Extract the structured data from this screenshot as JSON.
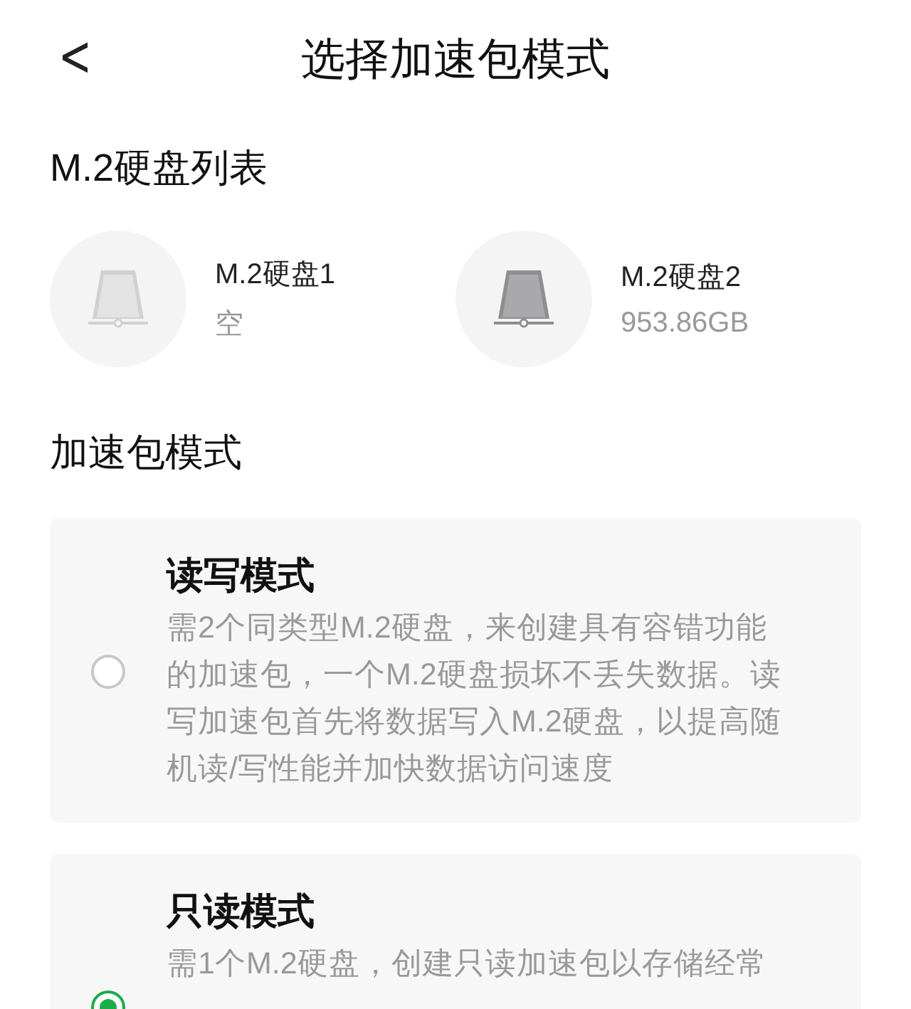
{
  "header": {
    "back": "<",
    "title": "选择加速包模式"
  },
  "disk_section": {
    "title": "M.2硬盘列表",
    "disks": [
      {
        "name": "M.2硬盘1",
        "capacity": "空",
        "occupied": false
      },
      {
        "name": "M.2硬盘2",
        "capacity": "953.86GB",
        "occupied": true
      }
    ]
  },
  "mode_section": {
    "title": "加速包模式",
    "modes": [
      {
        "title": "读写模式",
        "description": "需2个同类型M.2硬盘，来创建具有容错功能的加速包，一个M.2硬盘损坏不丢失数据。读写加速包首先将数据写入M.2硬盘，以提高随机读/写性能并加快数据访问速度",
        "selected": false
      },
      {
        "title": "只读模式",
        "description": "需1个M.2硬盘，创建只读加速包以存储经常",
        "selected": true
      }
    ]
  }
}
